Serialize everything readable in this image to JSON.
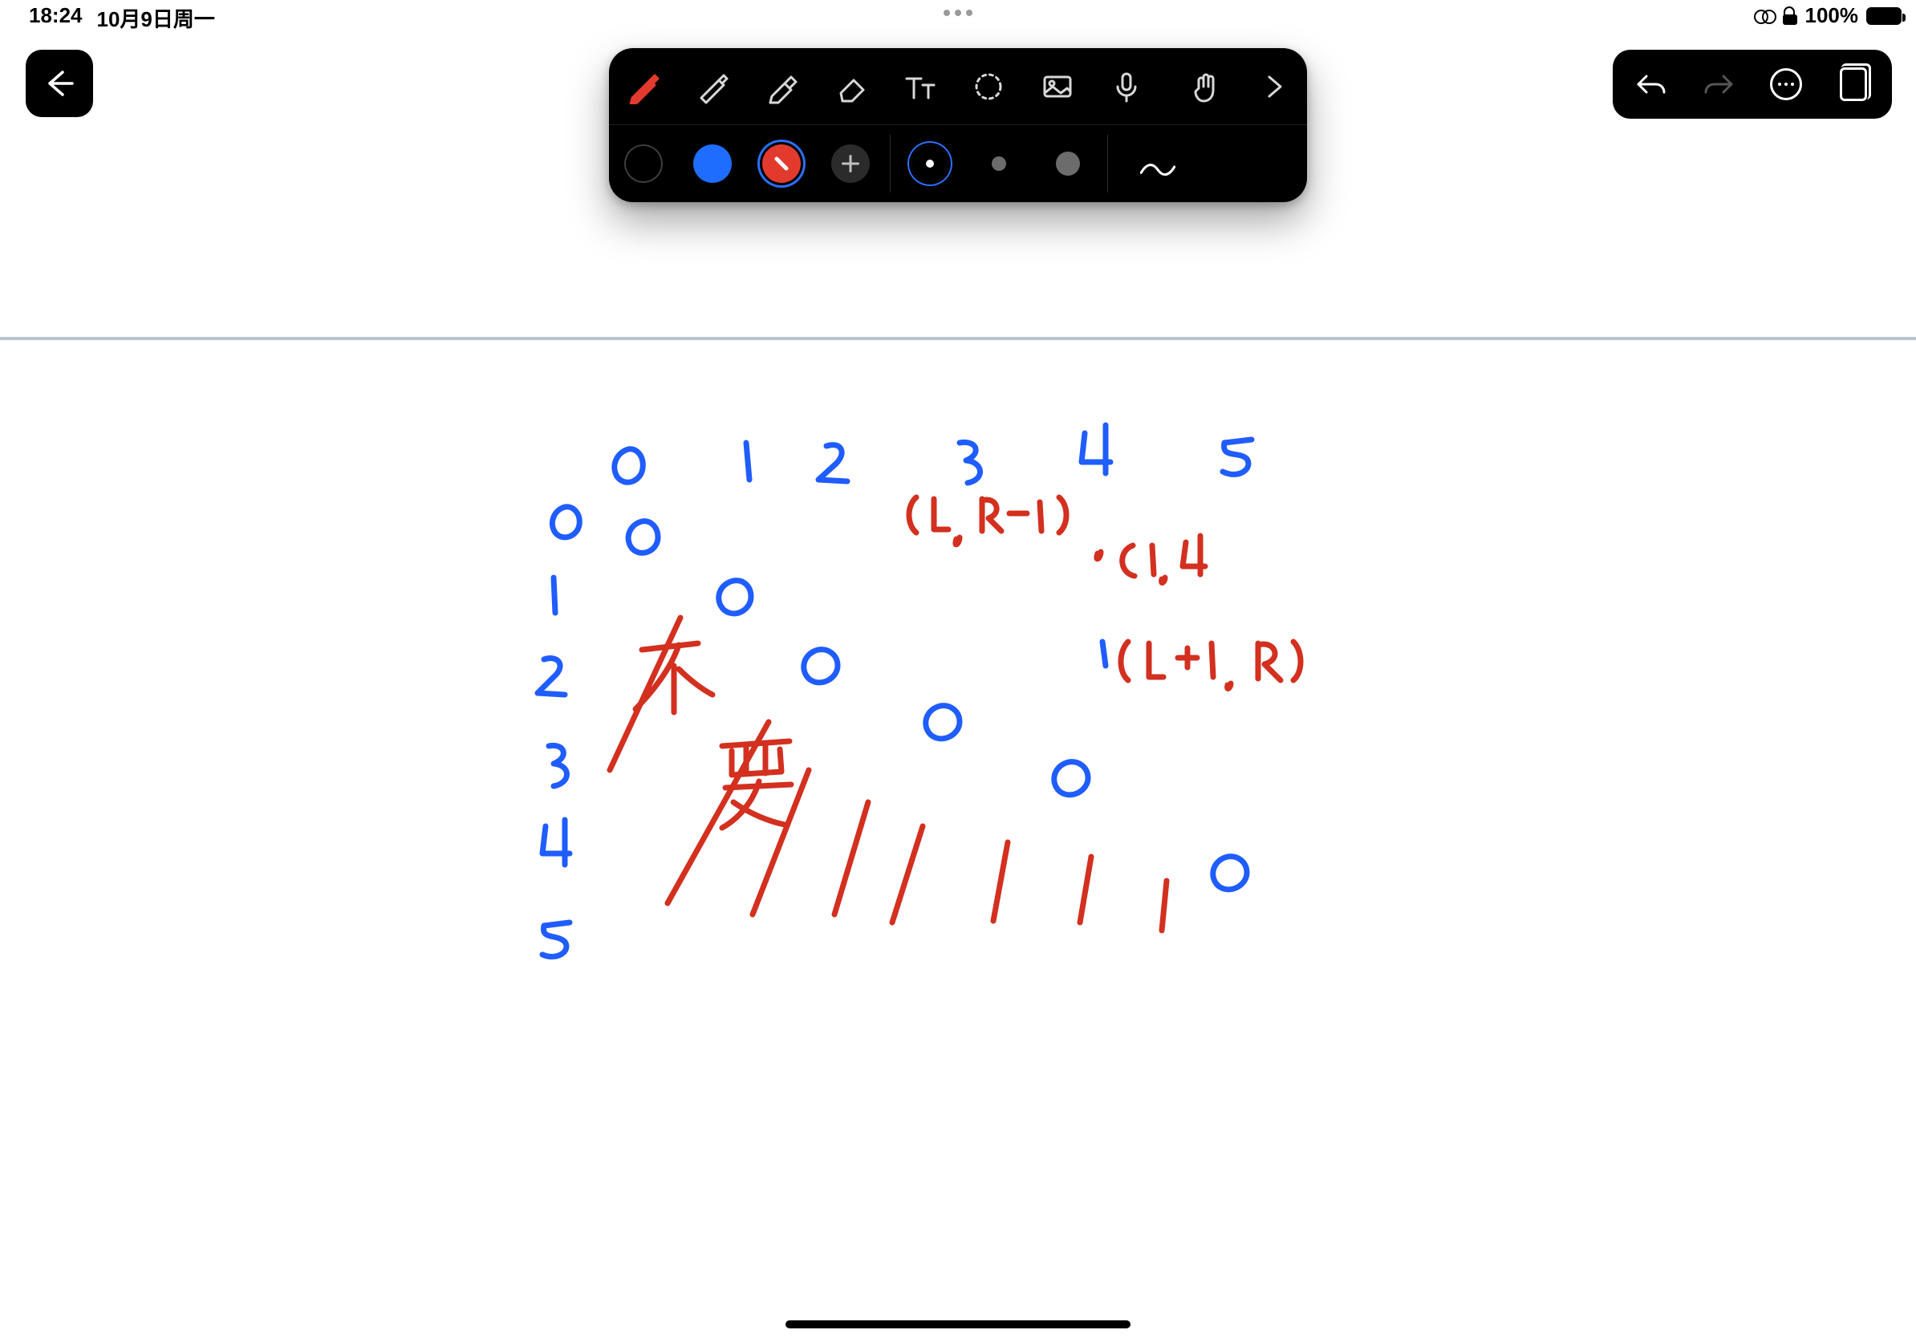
{
  "status_bar": {
    "time": "18:24",
    "date": "10月9日周一",
    "battery_text": "100%"
  },
  "canvas": {
    "headers": [
      "0",
      "1",
      "2",
      "3",
      "4",
      "5"
    ],
    "row_labels": [
      "0",
      "1",
      "2",
      "3",
      "4",
      "5"
    ],
    "annotations": {
      "lr_minus_1": "(L, R-1)",
      "c14": "C1,4",
      "lplus1_r": "(L+1, R)",
      "bu_yao": "不要"
    },
    "colors": {
      "blue": "#1f5dff",
      "red": "#d3301f"
    }
  },
  "toolbar": {
    "row1": {
      "pen": {
        "name": "pen-tool",
        "interactable": true,
        "active": true
      },
      "pencil": {
        "name": "pencil-tool",
        "interactable": true
      },
      "highlighter": {
        "name": "highlighter-tool",
        "interactable": true
      },
      "eraser": {
        "name": "eraser-tool",
        "interactable": true
      },
      "text": {
        "name": "text-tool",
        "interactable": true,
        "label": "Tt"
      },
      "lasso": {
        "name": "lasso-tool",
        "interactable": true
      },
      "image": {
        "name": "insert-image-tool",
        "interactable": true
      },
      "mic": {
        "name": "voice-tool",
        "interactable": true
      },
      "gesture": {
        "name": "gesture-tool",
        "interactable": true
      },
      "more": {
        "name": "toolbar-more",
        "interactable": true
      }
    },
    "row2": {
      "colors": [
        {
          "name": "color-black",
          "hex": "#000000",
          "interactable": true,
          "selected": false
        },
        {
          "name": "color-blue",
          "hex": "#1f6dff",
          "interactable": true,
          "selected": false
        },
        {
          "name": "color-red",
          "hex": "#e23b2e",
          "interactable": true,
          "selected": true
        },
        {
          "name": "color-add",
          "interactable": true
        }
      ],
      "stroke_sizes": [
        {
          "name": "stroke-small",
          "interactable": true,
          "selected": true
        },
        {
          "name": "stroke-medium",
          "interactable": true,
          "selected": false
        },
        {
          "name": "stroke-large",
          "interactable": true,
          "selected": false
        }
      ],
      "line_style": {
        "name": "stroke-style-wave",
        "interactable": true
      }
    }
  },
  "right_toolbar": {
    "undo": {
      "name": "undo-button",
      "interactable": true
    },
    "redo": {
      "name": "redo-button",
      "interactable": true,
      "enabled": false
    },
    "more": {
      "name": "more-menu-button",
      "interactable": true
    },
    "pages": {
      "name": "pages-button",
      "interactable": true
    }
  },
  "back_button": {
    "name": "back-button",
    "interactable": true
  }
}
